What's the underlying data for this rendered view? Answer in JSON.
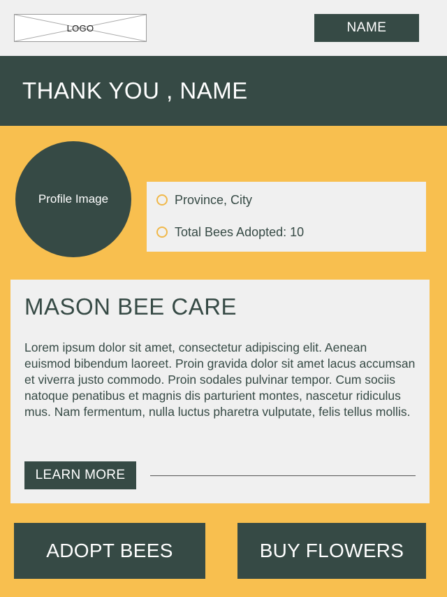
{
  "header": {
    "logo_text": "LOGO",
    "name_button": "NAME"
  },
  "banner": {
    "title": "THANK YOU , NAME"
  },
  "profile": {
    "image_label": "Profile Image",
    "location": "Province, City",
    "bees_adopted": "Total Bees Adopted: 10"
  },
  "care_card": {
    "title": "MASON BEE CARE",
    "body": "Lorem ipsum dolor sit amet, consectetur adipiscing elit. Aenean euismod bibendum laoreet. Proin gravida dolor sit amet lacus accumsan et viverra justo commodo. Proin sodales pulvinar tempor. Cum sociis natoque penatibus et magnis dis parturient montes, nascetur ridiculus mus. Nam fermentum, nulla luctus pharetra vulputate, felis tellus mollis.",
    "learn_more": "LEARN MORE"
  },
  "actions": {
    "adopt": "ADOPT BEES",
    "buy": "BUY FLOWERS"
  },
  "colors": {
    "background": "#f8bf4f",
    "dark": "#364a45",
    "light_panel": "#f0f0f0",
    "bullet": "#f0b84a"
  }
}
